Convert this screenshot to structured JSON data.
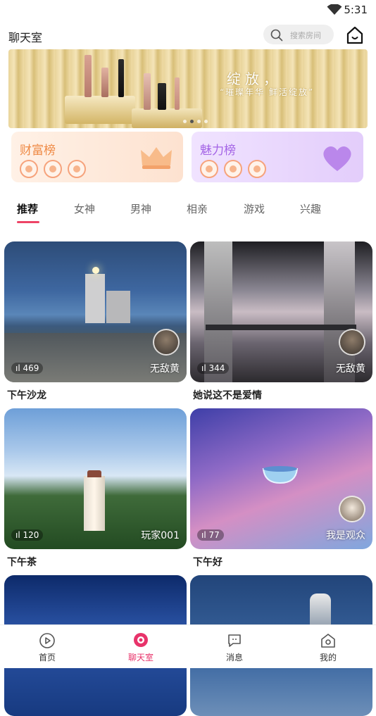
{
  "status_bar": {
    "time": "5:31"
  },
  "header": {
    "title": "聊天室",
    "search_placeholder": "搜索房间"
  },
  "banner": {
    "slogan_line1": "绽放，",
    "slogan_line2": "“璀璨年华 鲜活绽放”"
  },
  "ranks": [
    {
      "label": "财富榜"
    },
    {
      "label": "魅力榜"
    }
  ],
  "tabs": [
    {
      "label": "推荐",
      "active": true
    },
    {
      "label": "女神"
    },
    {
      "label": "男神"
    },
    {
      "label": "相亲"
    },
    {
      "label": "游戏"
    },
    {
      "label": "兴趣"
    }
  ],
  "rooms": [
    {
      "title": "下午沙龙",
      "count": "469",
      "host": "无敌黄"
    },
    {
      "title": "她说这不是爱情",
      "count": "344",
      "host": "无敌黄"
    },
    {
      "title": "下午茶",
      "count": "120",
      "host": "玩家001"
    },
    {
      "title": "下午好",
      "count": "77",
      "host": "我是观众"
    },
    {
      "title": "",
      "count": "",
      "host": ""
    },
    {
      "title": "",
      "count": "",
      "host": ""
    }
  ],
  "nav": [
    {
      "label": "首页",
      "icon": "play-circle-icon"
    },
    {
      "label": "聊天室",
      "icon": "chat-bubble-icon",
      "active": true
    },
    {
      "label": "消息",
      "icon": "message-icon"
    },
    {
      "label": "我的",
      "icon": "profile-icon"
    }
  ],
  "colors": {
    "accent": "#e8336a",
    "wealth": "#ef8a45",
    "charm": "#a464e6"
  }
}
